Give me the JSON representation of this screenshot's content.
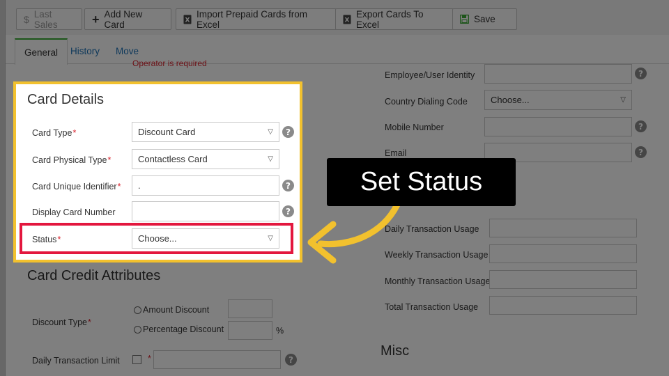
{
  "toolbar": {
    "last_sales": "Last Sales",
    "add_new_card": "Add New Card",
    "import_prepaid": "Import Prepaid Cards from Excel",
    "export_cards": "Export Cards To Excel",
    "save": "Save"
  },
  "tabs": [
    "General",
    "History",
    "Move"
  ],
  "error_text": "Operator is required",
  "card_details": {
    "title": "Card Details",
    "card_type_label": "Card Type",
    "card_type_value": "Discount Card",
    "physical_type_label": "Card Physical Type",
    "physical_type_value": "Contactless Card",
    "unique_id_label": "Card Unique Identifier",
    "unique_id_value": ".",
    "display_number_label": "Display Card Number",
    "display_number_value": "",
    "status_label": "Status",
    "status_value": "Choose..."
  },
  "credit": {
    "title": "Card Credit Attributes",
    "discount_type_label": "Discount Type",
    "amount_discount": "Amount Discount",
    "percentage_discount": "Percentage Discount",
    "percent_sign": "%",
    "daily_limit_label": "Daily Transaction Limit"
  },
  "right": {
    "employee_identity": "Employee/User Identity",
    "country_code": "Country Dialing Code",
    "country_code_value": "Choose...",
    "mobile": "Mobile Number",
    "email": "Email",
    "daily_usage": "Daily Transaction Usage",
    "weekly_usage": "Weekly Transaction Usage",
    "monthly_usage": "Monthly Transaction Usage",
    "total_usage": "Total Transaction Usage",
    "misc_title": "Misc"
  },
  "help_glyph": "?",
  "required_mark": "*",
  "caret_glyph": "▽",
  "callout_text": "Set Status",
  "colors": {
    "highlight_panel": "#f2c12e",
    "highlight_status": "#e3173e",
    "arrow": "#f2c12e",
    "tab_active_accent": "#3aaa35",
    "link": "#1f73b7"
  }
}
